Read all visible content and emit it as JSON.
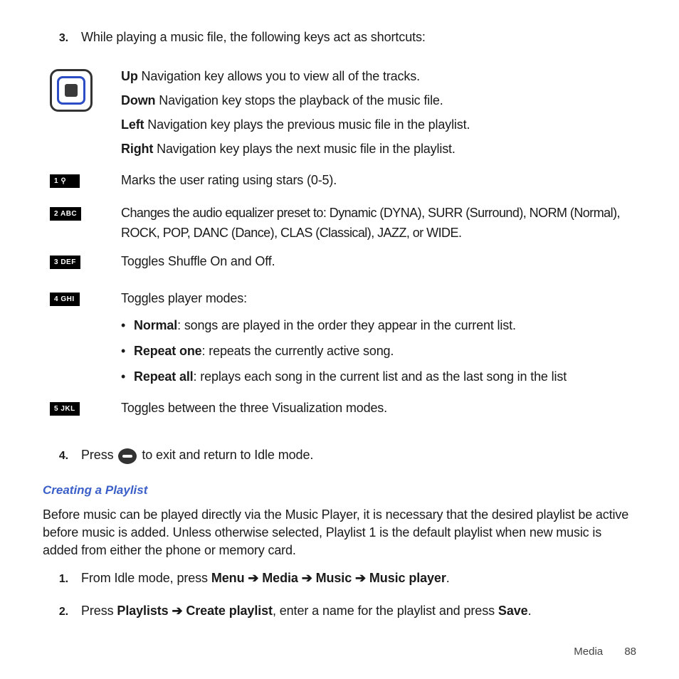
{
  "step3": {
    "num": "3.",
    "text": "While playing a music file, the following keys act as shortcuts:"
  },
  "nav": {
    "up": {
      "label": "Up",
      "text": " Navigation key allows you to view all of the tracks."
    },
    "down": {
      "label": "Down",
      "text": " Navigation key stops the playback of the music file."
    },
    "left": {
      "label": "Left",
      "text": " Navigation key plays the previous music file in the playlist."
    },
    "right": {
      "label": "Right",
      "text": " Navigation key plays the next music file in the playlist."
    }
  },
  "keys": {
    "k1": {
      "glyph": "1 ⚲",
      "text": "Marks the user rating using stars (0-5)."
    },
    "k2": {
      "glyph": "2 ABC",
      "text": "Changes the audio equalizer preset to: Dynamic (DYNA), SURR (Surround), NORM (Normal), ROCK, POP, DANC (Dance), CLAS (Classical), JAZZ, or WIDE."
    },
    "k3": {
      "glyph": "3 DEF",
      "text": "Toggles Shuffle On and Off."
    },
    "k4": {
      "glyph": "4 GHI",
      "intro": "Toggles player modes:",
      "m1_label": "Normal",
      "m1_text": ": songs are played in the order they appear in the current list.",
      "m2_label": "Repeat one",
      "m2_text": ": repeats the currently active song.",
      "m3_label": "Repeat all",
      "m3_text": ": replays each song in the current list and as the last song in the list"
    },
    "k5": {
      "glyph": "5 JKL",
      "text": "Toggles between the three Visualization modes."
    }
  },
  "step4": {
    "num": "4.",
    "pre": "Press ",
    "post": " to exit and return to Idle mode."
  },
  "heading": "Creating a Playlist",
  "intro": "Before music can be played directly via the Music Player, it is necessary that the desired playlist be active before music is added. Unless otherwise selected, Playlist 1 is the default playlist when new music is added from either the phone or memory card.",
  "steps": {
    "s1": {
      "num": "1.",
      "pre": "From Idle mode, press ",
      "p1": "Menu",
      "a": " ➔ ",
      "p2": "Media",
      "p3": "Music",
      "p4": "Music player",
      "end": "."
    },
    "s2": {
      "num": "2.",
      "pre": "Press ",
      "p1": "Playlists",
      "a": " ➔ ",
      "p2": "Create playlist",
      "mid": ", enter a name for the playlist and press ",
      "p3": "Save",
      "end": "."
    }
  },
  "footer": {
    "section": "Media",
    "page": "88"
  }
}
